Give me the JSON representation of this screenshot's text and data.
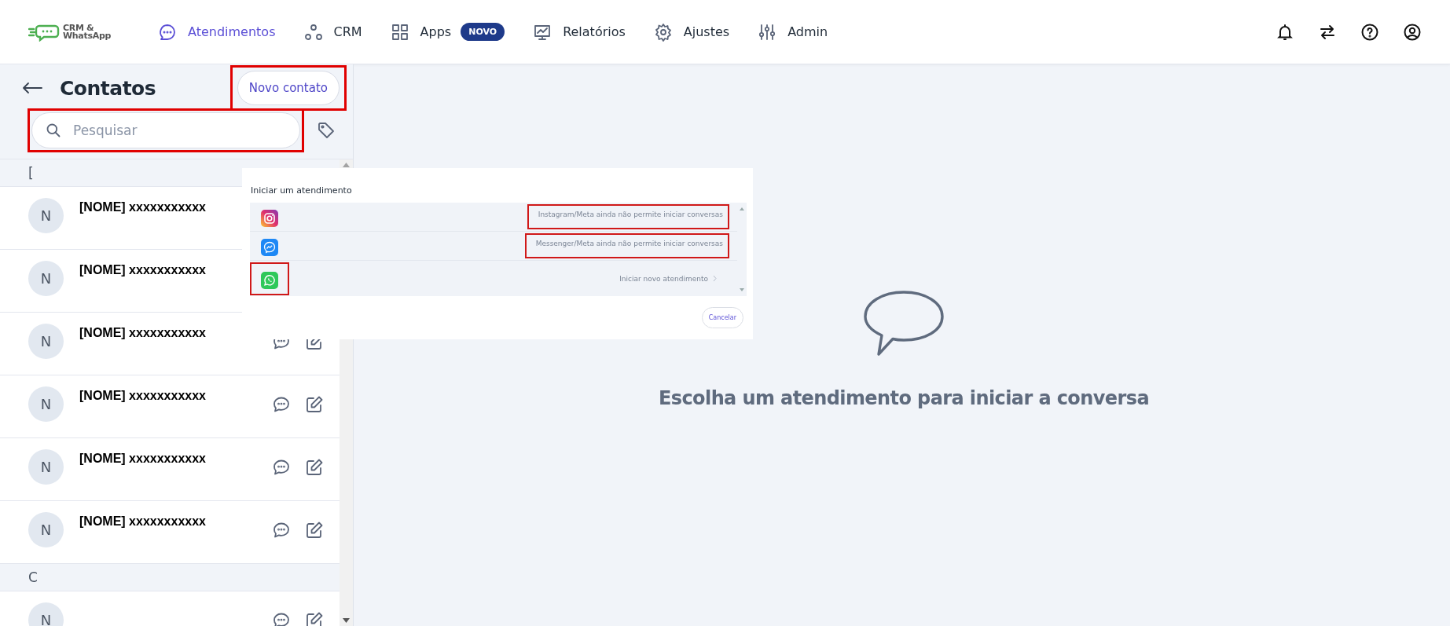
{
  "logo": {
    "line1": "CRM &",
    "line2": "WhatsApp"
  },
  "nav": [
    {
      "label": "Atendimentos",
      "kind": "chat",
      "selected": true
    },
    {
      "label": "CRM",
      "kind": "nodes",
      "selected": false
    },
    {
      "label": "Apps",
      "kind": "grid",
      "selected": false,
      "badge": "NOVO"
    },
    {
      "label": "Relatórios",
      "kind": "chart",
      "selected": false
    },
    {
      "label": "Ajustes",
      "kind": "gear",
      "selected": false
    },
    {
      "label": "Admin",
      "kind": "sliders",
      "selected": false
    }
  ],
  "header_actions": [
    {
      "kind": "bell"
    },
    {
      "kind": "swap"
    },
    {
      "kind": "help"
    },
    {
      "kind": "user"
    }
  ],
  "contacts": {
    "title": "Contatos",
    "new_button": {
      "label": "Novo contato",
      "highlighted": true
    },
    "search": {
      "placeholder": "Pesquisar",
      "highlighted": true
    },
    "sections": [
      {
        "letter": "[",
        "contacts": [
          {
            "initial": "N",
            "name": "[NOME] xxxxxxxxxxx"
          },
          {
            "initial": "N",
            "name": "[NOME] xxxxxxxxxxx"
          },
          {
            "initial": "N",
            "name": "[NOME] xxxxxxxxxxx"
          },
          {
            "initial": "N",
            "name": "[NOME] xxxxxxxxxxx"
          },
          {
            "initial": "N",
            "name": "[NOME] xxxxxxxxxxx"
          },
          {
            "initial": "N",
            "name": "[NOME] xxxxxxxxxxx"
          }
        ]
      },
      {
        "letter": "C",
        "contacts": [
          {
            "initial": "N"
          }
        ]
      }
    ]
  },
  "dialog": {
    "title": "Iniciar um atendimento",
    "channels": [
      {
        "kind": "instagram",
        "note": "Instagram/Meta ainda não permite iniciar conversas",
        "highlighted": true
      },
      {
        "kind": "messenger",
        "note": "Messenger/Meta ainda não permite iniciar conversas",
        "highlighted": true
      },
      {
        "kind": "whatsapp",
        "action": "Iniciar novo atendimento",
        "highlighted": true
      }
    ],
    "cancel": "Cancelar"
  },
  "empty_state": {
    "message": "Escolha um atendimento para iniciar a conversa"
  }
}
